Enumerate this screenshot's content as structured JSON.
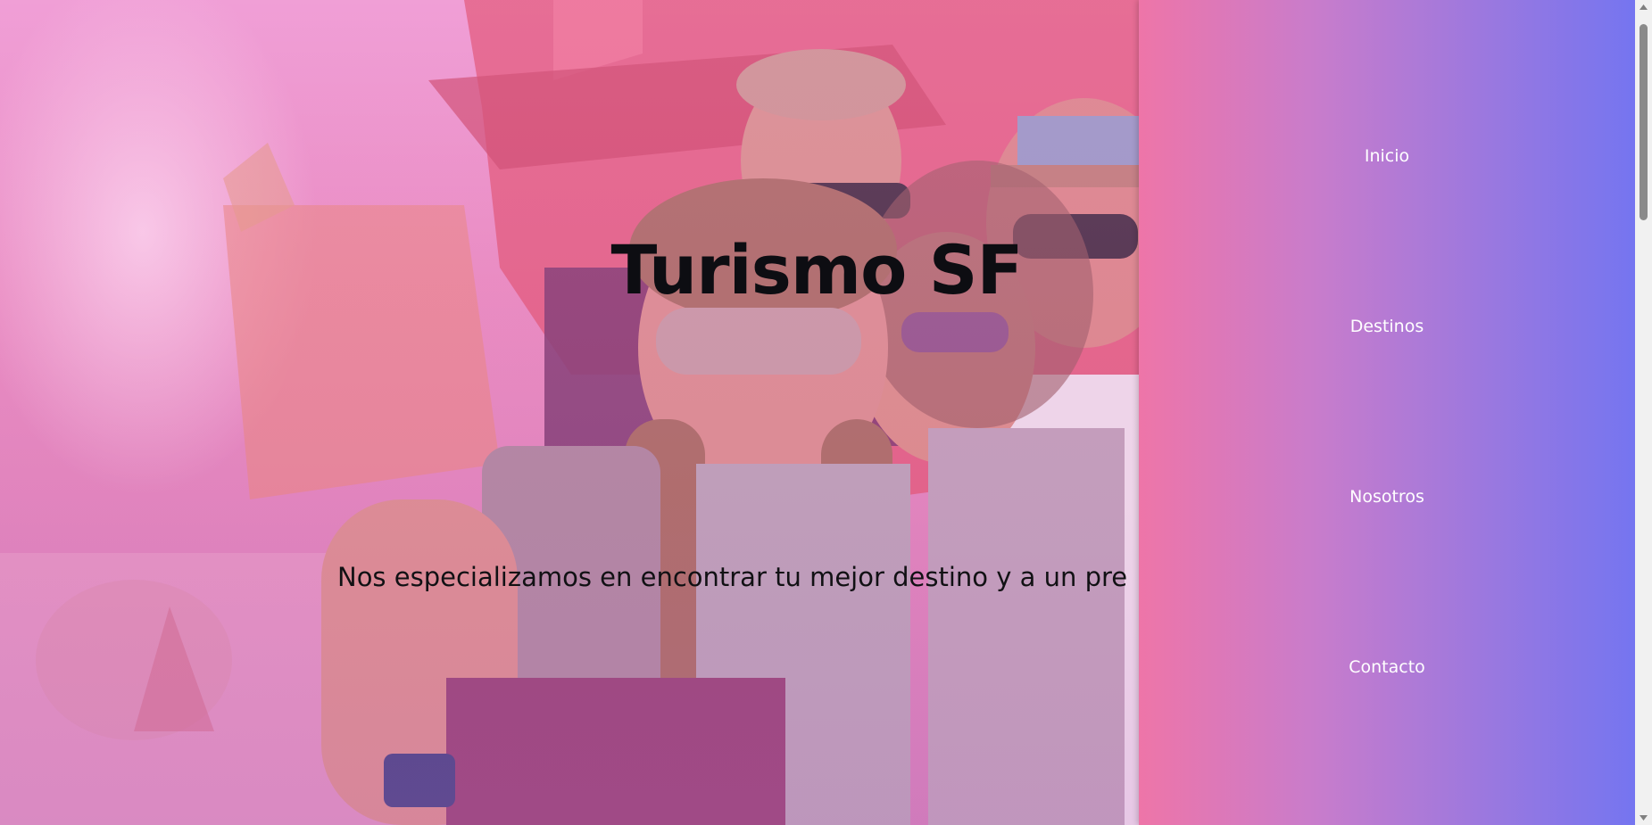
{
  "hero": {
    "title": "Turismo SF",
    "subtitle": "Nos especializamos en encontrar tu mejor destino y a un pre",
    "image_icon": "hero-photo-friends-traveling"
  },
  "nav": {
    "items": [
      {
        "label": "Inicio"
      },
      {
        "label": "Destinos"
      },
      {
        "label": "Nosotros"
      },
      {
        "label": "Contacto"
      }
    ],
    "gradient_start": "#ee75a8",
    "gradient_end": "#7575f0"
  },
  "scrollbar": {
    "up_icon": "chevron-up-icon",
    "down_icon": "chevron-down-icon"
  }
}
